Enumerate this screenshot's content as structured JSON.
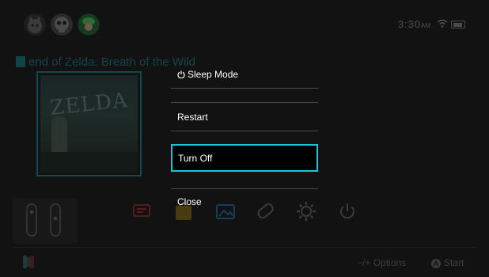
{
  "status_bar": {
    "time": "3:30",
    "ampm": "AM",
    "wifi_icon": "wifi-icon",
    "battery_icon": "battery-icon"
  },
  "background": {
    "game_title": "end of Zelda: Breath of the Wild",
    "tile_text": "ZELDA",
    "home_icons": [
      "news-icon",
      "eshop-icon",
      "album-icon",
      "controllers-icon",
      "settings-icon",
      "power-icon"
    ],
    "footer": {
      "options_label": "Options",
      "options_keys": "−/+",
      "start_button": "A",
      "start_label": "Start"
    }
  },
  "power_menu": {
    "items": [
      {
        "label": "Sleep Mode",
        "icon": "power-icon"
      },
      {
        "label": "Restart"
      },
      {
        "label": "Turn Off",
        "selected": true
      },
      {
        "label": "Close"
      }
    ],
    "accent": "#19c8d2"
  }
}
